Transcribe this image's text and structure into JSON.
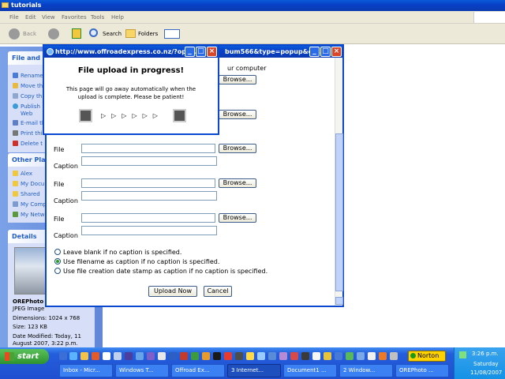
{
  "explorer": {
    "title": "tutorials",
    "menu": [
      "File",
      "Edit",
      "View",
      "Favorites",
      "Tools",
      "Help"
    ],
    "toolbar": {
      "back": "Back",
      "search": "Search",
      "folders": "Folders"
    },
    "file_folder_tasks": {
      "heading": "File and Fol",
      "items": [
        "Rename",
        "Move th",
        "Copy th",
        "Publish",
        "Web",
        "E-mail th",
        "Print thi",
        "Delete t"
      ]
    },
    "other_places": {
      "heading": "Other Place",
      "items": [
        "Alex",
        "My Docu",
        "Shared",
        "My Comp",
        "My Netw"
      ]
    },
    "details": {
      "heading": "Details",
      "name": "OREPhoto",
      "type": "JPEG Image",
      "dimensions": "Dimensions: 1024 x 768",
      "size": "Size: 123 KB",
      "modified1": "Date Modified: Today, 11",
      "modified2": "August 2007, 3:22 p.m."
    }
  },
  "popup_back": {
    "title_fragment": "bum566&type=popup&op...",
    "top_text": "ur computer"
  },
  "upload_form": {
    "rows": [
      {
        "file_label": "",
        "caption_label": "",
        "browse": "Browse..."
      },
      {
        "file_label": "",
        "caption_label": "",
        "browse": "Browse..."
      },
      {
        "file_label": "File",
        "caption_label": "Caption",
        "browse": "Browse..."
      },
      {
        "file_label": "File",
        "caption_label": "Caption",
        "browse": "Browse..."
      },
      {
        "file_label": "File",
        "caption_label": "Caption",
        "browse": "Browse..."
      }
    ],
    "options": [
      "Leave blank if no caption is specified.",
      "Use filename as caption if no caption is specified.",
      "Use file creation date stamp as caption if no caption is specified."
    ],
    "selected_option": 1,
    "upload_button": "Upload Now",
    "cancel_button": "Cancel"
  },
  "progress_popup": {
    "title": "http://www.offroadexpress.co.nz/?op-...",
    "heading": "File upload in progress!",
    "message": "This page will go away automatically when the upload is complete. Please be patient!"
  },
  "taskbar": {
    "start": "start",
    "norton": "Norton",
    "tasks": [
      "Inbox - Micr...",
      "Windows T...",
      "Offroad Ex...",
      "3 Internet...",
      "Document1 ...",
      "2 Window...",
      "OREPhoto ..."
    ],
    "active_task": 3,
    "clock": {
      "time": "3:26 p.m.",
      "day": "Saturday",
      "date": "11/08/2007"
    }
  }
}
